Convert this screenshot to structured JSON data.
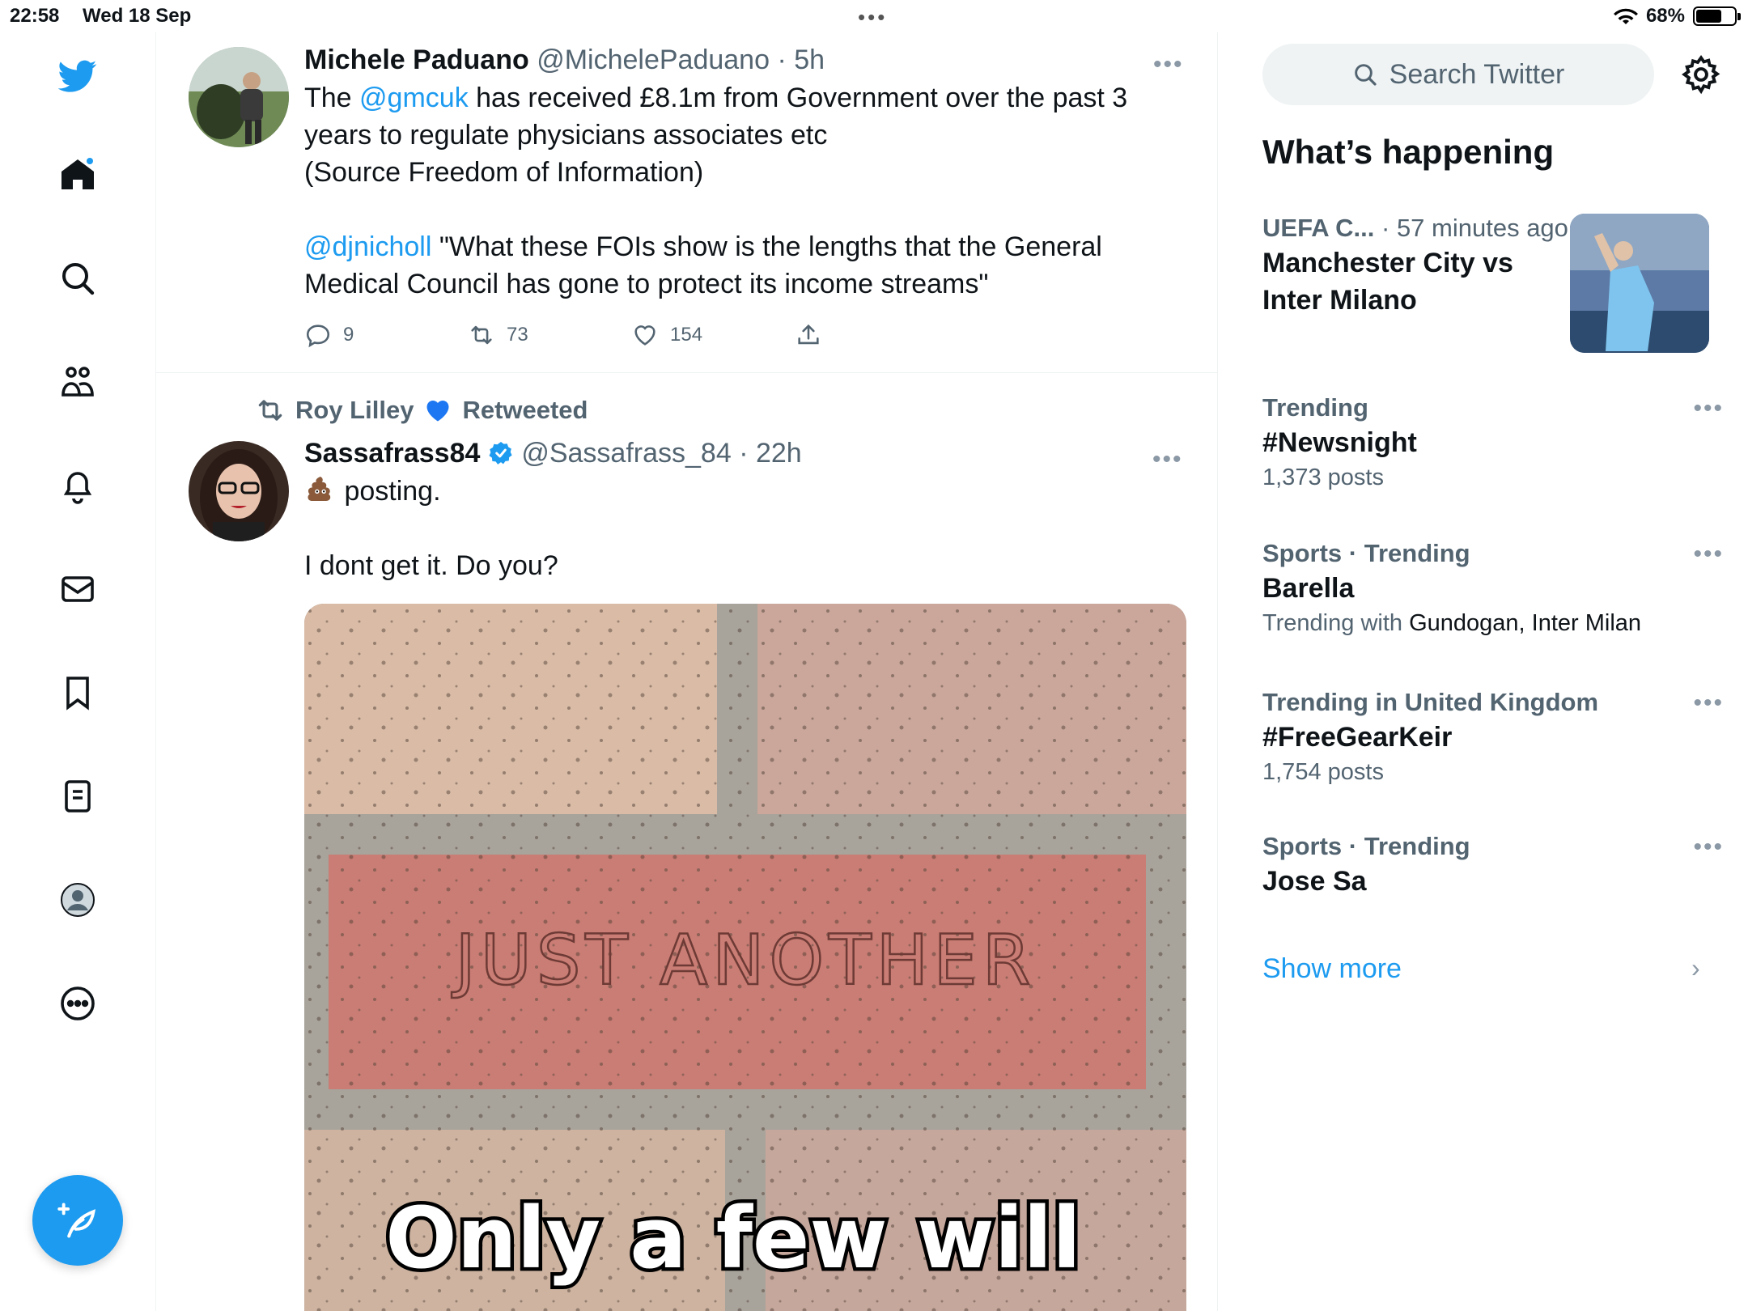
{
  "status_bar": {
    "time": "22:58",
    "date": "Wed 18 Sep",
    "battery": "68%",
    "battery_level": 0.68
  },
  "nav": {
    "icons": [
      "twitter-logo-icon",
      "home-icon",
      "search-icon",
      "communities-icon",
      "notifications-icon",
      "messages-icon",
      "bookmarks-icon",
      "lists-icon",
      "profile-icon",
      "more-icon"
    ],
    "accent": "#1d9bf0"
  },
  "tweets": [
    {
      "name": "Michele Paduano",
      "handle": "@MichelePaduano",
      "time": "5h",
      "text_lines": [
        "The @gmcuk has received £8.1m from Government over the past 3",
        "years to regulate physicians associates etc",
        "(Source Freedom of Information)",
        "",
        "@djnicholl  \"What these FOIs show is the lengths that the General",
        "Medical Council has gone to protect its income streams\""
      ],
      "mention_1": "@gmcuk",
      "text_line1_pre": "The ",
      "text_line1_post": " has received £8.1m from Government over the past 3",
      "mention_2": "@djnicholl",
      "text_line5_post": "  \"What these FOIs show is the lengths that the General",
      "replies": "9",
      "retweets": "73",
      "likes": "154"
    },
    {
      "retweeted_by": "Roy Lilley",
      "retweeted_label": "Retweeted",
      "name": "Sassafrass84",
      "handle": "@Sassafrass_84",
      "time": "22h",
      "line_1": "posting.",
      "line_2": "",
      "line_3": "I dont get it. Do you?",
      "media_text_1": "JUST ANOTHER",
      "media_text_2": "Only a few will"
    }
  ],
  "sidebar": {
    "search_placeholder": "Search Twitter",
    "title": "What’s happening",
    "trends": [
      {
        "meta": "UEFA C...",
        "meta_time": "57 minutes ago",
        "name_line1": "Manchester City vs",
        "name_line2": "Inter Milano"
      },
      {
        "meta": "Trending",
        "name": "#Newsnight",
        "sub": "1,373 posts"
      },
      {
        "meta": "Sports · Trending",
        "name": "Barella",
        "sub_label": "Trending with",
        "sub_value": "Gundogan, Inter Milan"
      },
      {
        "meta": "Trending in United Kingdom",
        "name": "#FreeGearKeir",
        "sub": "1,754 posts"
      },
      {
        "meta": "Sports · Trending",
        "name": "Jose Sa"
      }
    ],
    "show_more": "Show more"
  }
}
